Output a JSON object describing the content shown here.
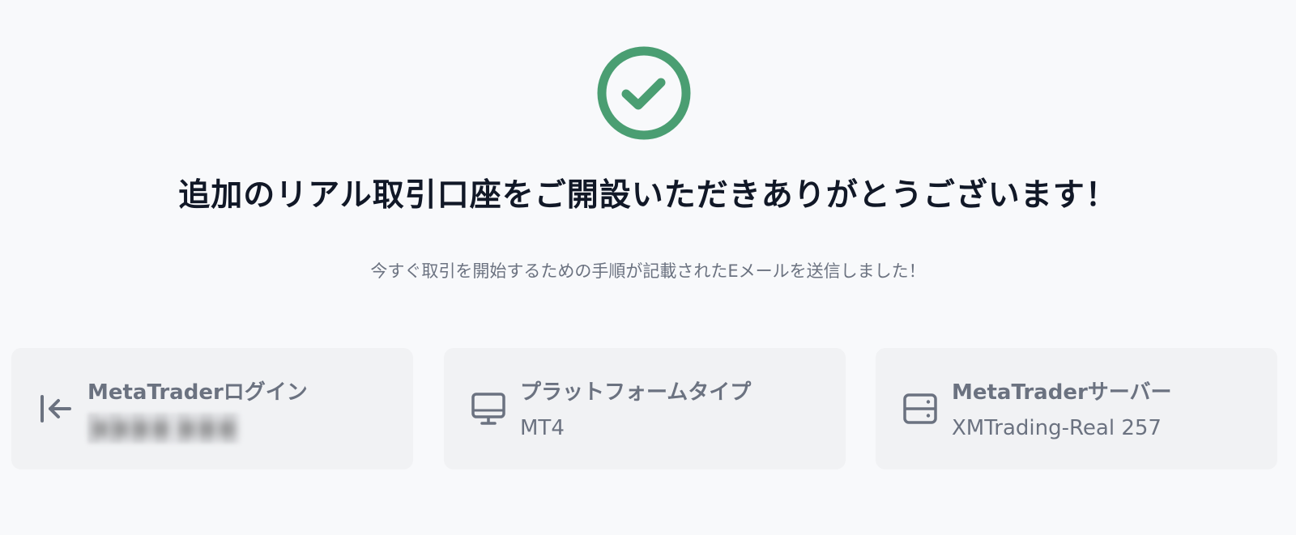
{
  "header": {
    "success_icon": "check-circle-icon",
    "title": "追加のリアル取引口座をご開設いただきありがとうございます！",
    "subtitle": "今すぐ取引を開始するための手順が記載されたEメールを送信しました！"
  },
  "cards": [
    {
      "icon": "login-arrow-icon",
      "label": "MetaTraderログイン",
      "value": "■■■■ ■■■"
    },
    {
      "icon": "monitor-icon",
      "label": "プラットフォームタイプ",
      "value": "MT4"
    },
    {
      "icon": "server-icon",
      "label": "MetaTraderサーバー",
      "value": "XMTrading-Real 257"
    }
  ],
  "colors": {
    "success": "#4a9e72",
    "background": "#f8f9fb",
    "card": "#f1f2f4",
    "muted_text": "#6b7280",
    "title_text": "#111827"
  }
}
